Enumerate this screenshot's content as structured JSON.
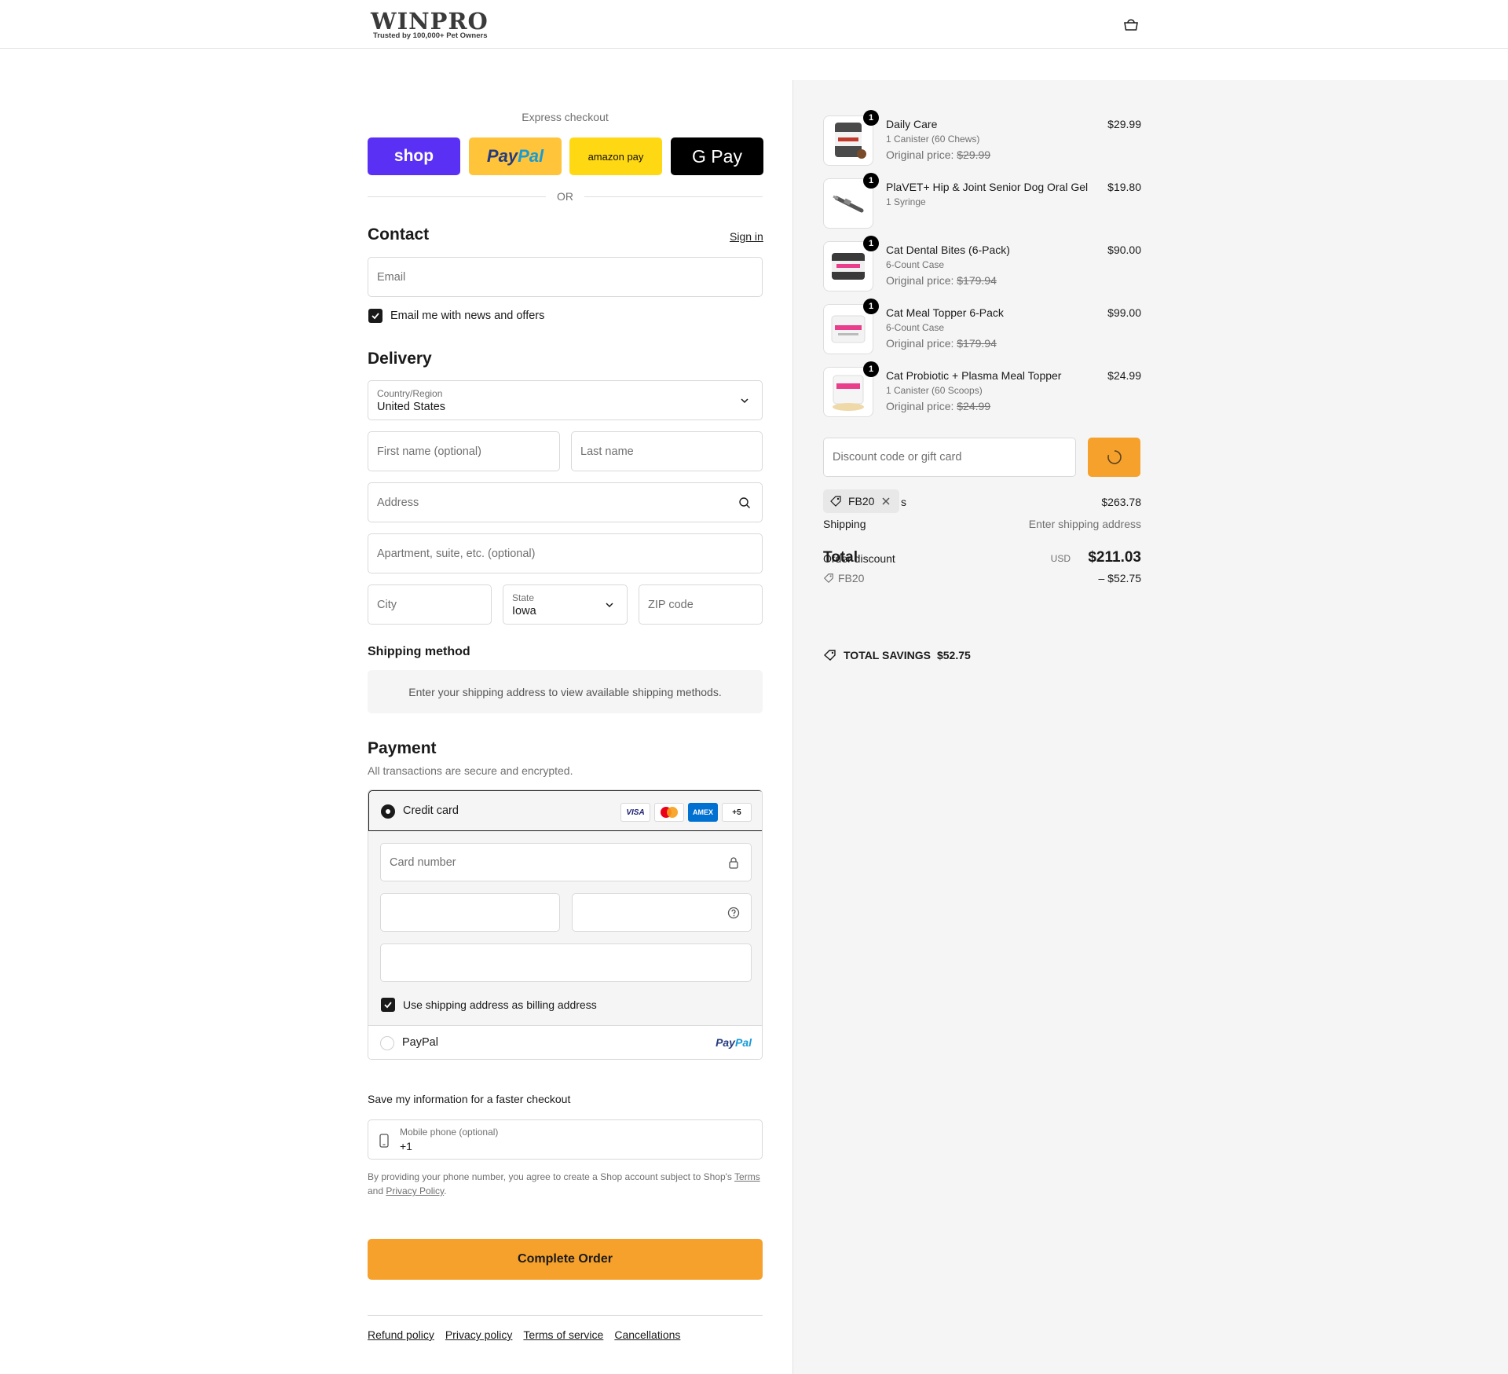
{
  "brand": {
    "name": "WINPRO",
    "tagline": "Trusted by 100,000+ Pet Owners"
  },
  "express": {
    "title": "Express checkout",
    "shop_label": "shop",
    "paypal_label_1": "Pay",
    "paypal_label_2": "Pal",
    "amazon_label": "amazon pay",
    "gpay_label": "G Pay",
    "or": "OR"
  },
  "contact": {
    "title": "Contact",
    "sign_in": "Sign in",
    "email_placeholder": "Email",
    "news_label": "Email me with news and offers",
    "news_checked": true
  },
  "delivery": {
    "title": "Delivery",
    "country_label": "Country/Region",
    "country_value": "United States",
    "first_name": "First name (optional)",
    "last_name": "Last name",
    "address": "Address",
    "apartment": "Apartment, suite, etc. (optional)",
    "city": "City",
    "state_label": "State",
    "state_value": "Iowa",
    "zip": "ZIP code"
  },
  "shipping_method": {
    "title": "Shipping method",
    "info": "Enter your shipping address to view available shipping methods."
  },
  "payment": {
    "title": "Payment",
    "subtitle": "All transactions are secure and encrypted.",
    "credit_card_label": "Credit card",
    "cards": [
      "VISA",
      "MC",
      "AMEX",
      "+5"
    ],
    "card_number": "Card number",
    "billing_label": "Use shipping address as billing address",
    "paypal_option": "PayPal",
    "paypal_logo_1": "Pay",
    "paypal_logo_2": "Pal"
  },
  "save_info": {
    "title": "Save my information for a faster checkout",
    "phone_label": "Mobile phone (optional)",
    "phone_value": "+1",
    "legal_1": "By providing your phone number, you agree to create a Shop account subject to Shop's",
    "terms": "Terms",
    "legal_and": "and",
    "privacy": "Privacy Policy",
    "legal_end": "."
  },
  "complete_button": "Complete Order",
  "footer": [
    "Refund policy",
    "Privacy policy",
    "Terms of service",
    "Cancellations"
  ],
  "cart": {
    "items": [
      {
        "qty": "1",
        "name": "Daily Care",
        "variant": "1 Canister (60 Chews)",
        "orig_label": "Original price:",
        "orig_price": "$29.99",
        "price": "$29.99"
      },
      {
        "qty": "1",
        "name": "PlaVET+ Hip & Joint Senior Dog Oral Gel",
        "variant": "1 Syringe",
        "orig_label": "",
        "orig_price": "",
        "price": "$19.80"
      },
      {
        "qty": "1",
        "name": "Cat Dental Bites (6-Pack)",
        "variant": "6-Count Case",
        "orig_label": "Original price:",
        "orig_price": "$179.94",
        "price": "$90.00"
      },
      {
        "qty": "1",
        "name": "Cat Meal Topper 6-Pack",
        "variant": "6-Count Case",
        "orig_label": "Original price:",
        "orig_price": "$179.94",
        "price": "$99.00"
      },
      {
        "qty": "1",
        "name": "Cat Probiotic + Plasma Meal Topper",
        "variant": "1 Canister (60 Scoops)",
        "orig_label": "Original price:",
        "orig_price": "$24.99",
        "price": "$24.99"
      }
    ],
    "discount_placeholder": "Discount code or gift card",
    "applied_code": "FB20",
    "subtotal_suffix": "s",
    "subtotal": "$263.78",
    "shipping_label": "Shipping",
    "shipping_value": "Enter shipping address",
    "total_label": "Total",
    "order_discount_label": "Order discount",
    "currency": "USD",
    "total": "$211.03",
    "discount_code": "FB20",
    "discount_amount": "– $52.75",
    "savings_label": "TOTAL SAVINGS",
    "savings_value": "$52.75"
  }
}
